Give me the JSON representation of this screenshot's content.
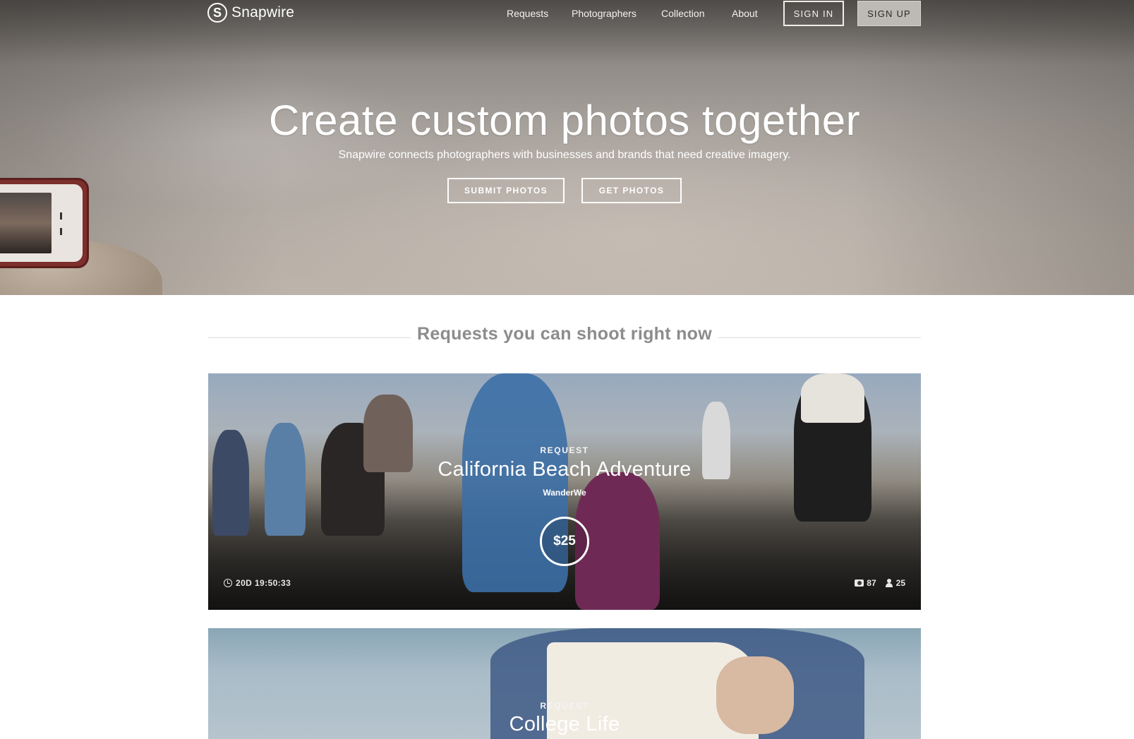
{
  "brand": {
    "name": "Snapwire",
    "logo_glyph": "S"
  },
  "nav": {
    "links": [
      {
        "label": "Requests"
      },
      {
        "label": "Photographers"
      },
      {
        "label": "Collection"
      },
      {
        "label": "About"
      }
    ],
    "sign_in": "SIGN IN",
    "sign_up": "SIGN UP"
  },
  "hero": {
    "title": "Create custom photos together",
    "subtitle": "Snapwire connects photographers with businesses and brands that need creative imagery.",
    "submit_button": "SUBMIT PHOTOS",
    "get_button": "GET PHOTOS"
  },
  "requests_section": {
    "title": "Requests you can shoot right now"
  },
  "requests": [
    {
      "kicker": "REQUEST",
      "title": "California Beach Adventure",
      "author": "WanderWe",
      "price": "$25",
      "time_left": "20D 19:50:33",
      "photo_count": "87",
      "photographer_count": "25"
    },
    {
      "kicker": "REQUEST",
      "title": "College Life"
    }
  ],
  "colors": {
    "text_white": "#ffffff",
    "section_gray": "#8c8c8c",
    "sign_up_bg": "#bdbab6"
  }
}
